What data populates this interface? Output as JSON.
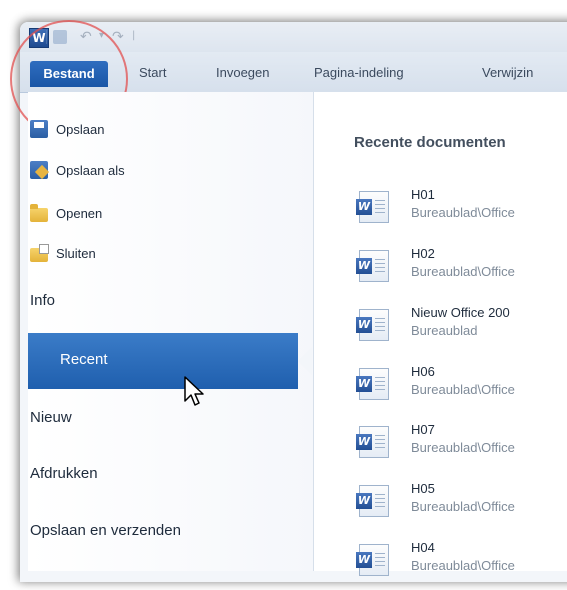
{
  "app": {
    "logo_letter": "W"
  },
  "tabs": {
    "file": "Bestand",
    "items": [
      "Start",
      "Invoegen",
      "Pagina-indeling",
      "Verwijzin"
    ]
  },
  "sidebar": {
    "commands": [
      {
        "label": "Opslaan",
        "icon": "save-icon"
      },
      {
        "label": "Opslaan als",
        "icon": "save-as-icon"
      },
      {
        "label": "Openen",
        "icon": "open-folder-icon"
      },
      {
        "label": "Sluiten",
        "icon": "close-file-icon"
      }
    ],
    "nav": [
      "Info",
      "Recent",
      "Nieuw",
      "Afdrukken",
      "Opslaan en verzenden"
    ],
    "selected": "Recent"
  },
  "recent": {
    "title": "Recente documenten",
    "documents": [
      {
        "name": "H01",
        "path": "Bureaublad\\Office"
      },
      {
        "name": "H02",
        "path": "Bureaublad\\Office"
      },
      {
        "name": "Nieuw Office 200",
        "path": "Bureaublad"
      },
      {
        "name": "H06",
        "path": "Bureaublad\\Office"
      },
      {
        "name": "H07",
        "path": "Bureaublad\\Office"
      },
      {
        "name": "H05",
        "path": "Bureaublad\\Office"
      },
      {
        "name": "H04",
        "path": "Bureaublad\\Office"
      }
    ]
  },
  "colors": {
    "accent": "#2a68b8",
    "highlight_circle": "#e25050"
  }
}
